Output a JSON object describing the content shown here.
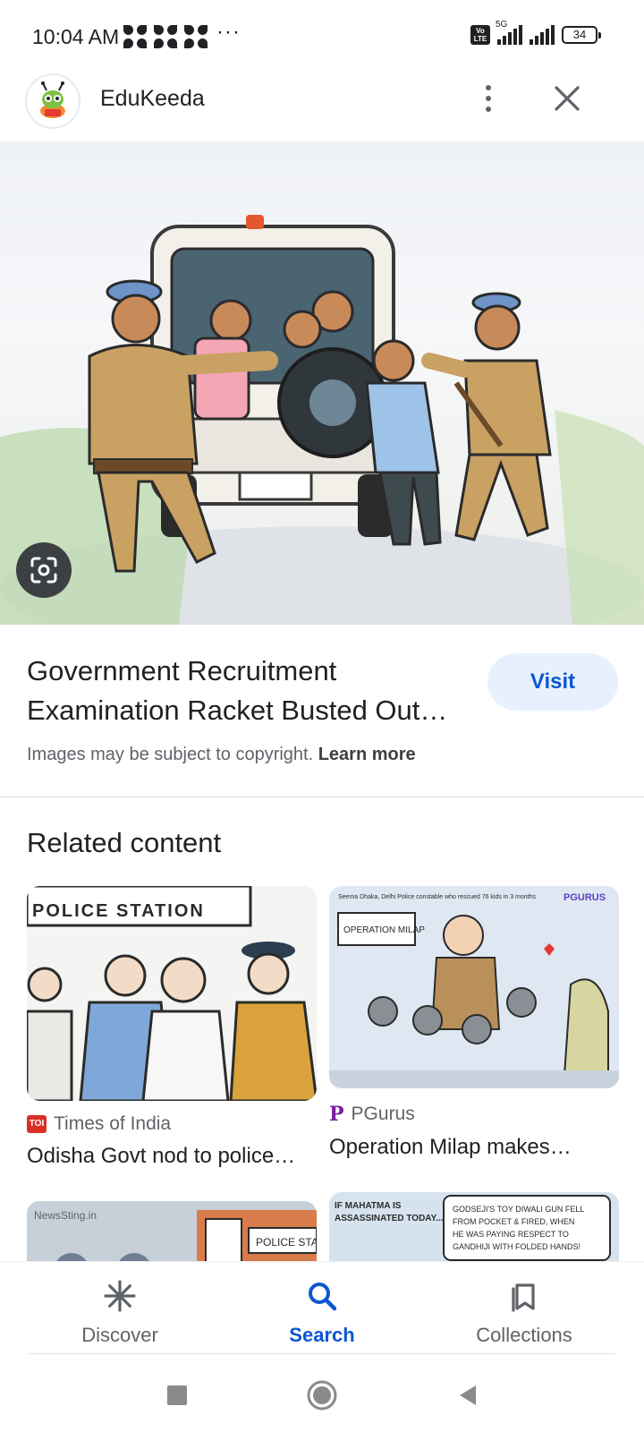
{
  "status_bar": {
    "time": "10:04 AM",
    "more": "···",
    "volte": "Vo LTE",
    "network": "5G",
    "battery": "34"
  },
  "header": {
    "site_name": "EduKeeda"
  },
  "result": {
    "title": "Government Recruitment Examination Racket Busted Out…",
    "visit_label": "Visit",
    "copyright_text": "Images may be subject to copyright.",
    "learn_more_label": "Learn more"
  },
  "related": {
    "heading": "Related content",
    "cards": [
      {
        "source": "Times of India",
        "source_badge": "TOI",
        "caption": "Odisha Govt nod to police…",
        "thumb_text": "POLICE STATION"
      },
      {
        "source": "PGurus",
        "source_badge": "P",
        "caption": "Operation Milap makes…",
        "thumb_text": "OPERATION MILAP",
        "thumb_top": "Seema Dhaka, Delhi Police constable who rescued 76 kids in 3 months",
        "thumb_brand": "PGURUS"
      },
      {
        "thumb_text": "POLICE STA",
        "thumb_brand": "NewsSting.in"
      },
      {
        "thumb_text": "IF MAHATMA IS ASSASSINATED TODAY...",
        "thumb_bubble": "GODSEJI'S TOY DIWALI GUN FELL FROM POCKET & FIRED, WHEN HE WAS PAYING RESPECT TO GANDHIJI WITH FOLDED HANDS!"
      }
    ]
  },
  "bottom_nav": {
    "items": [
      {
        "label": "Discover",
        "icon": "asterisk-icon"
      },
      {
        "label": "Search",
        "icon": "search-icon",
        "active": true
      },
      {
        "label": "Collections",
        "icon": "collections-icon"
      }
    ]
  },
  "colors": {
    "accent": "#0b57d0",
    "visit_bg": "#e8f0fe",
    "text": "#202124",
    "muted": "#5f6368"
  }
}
